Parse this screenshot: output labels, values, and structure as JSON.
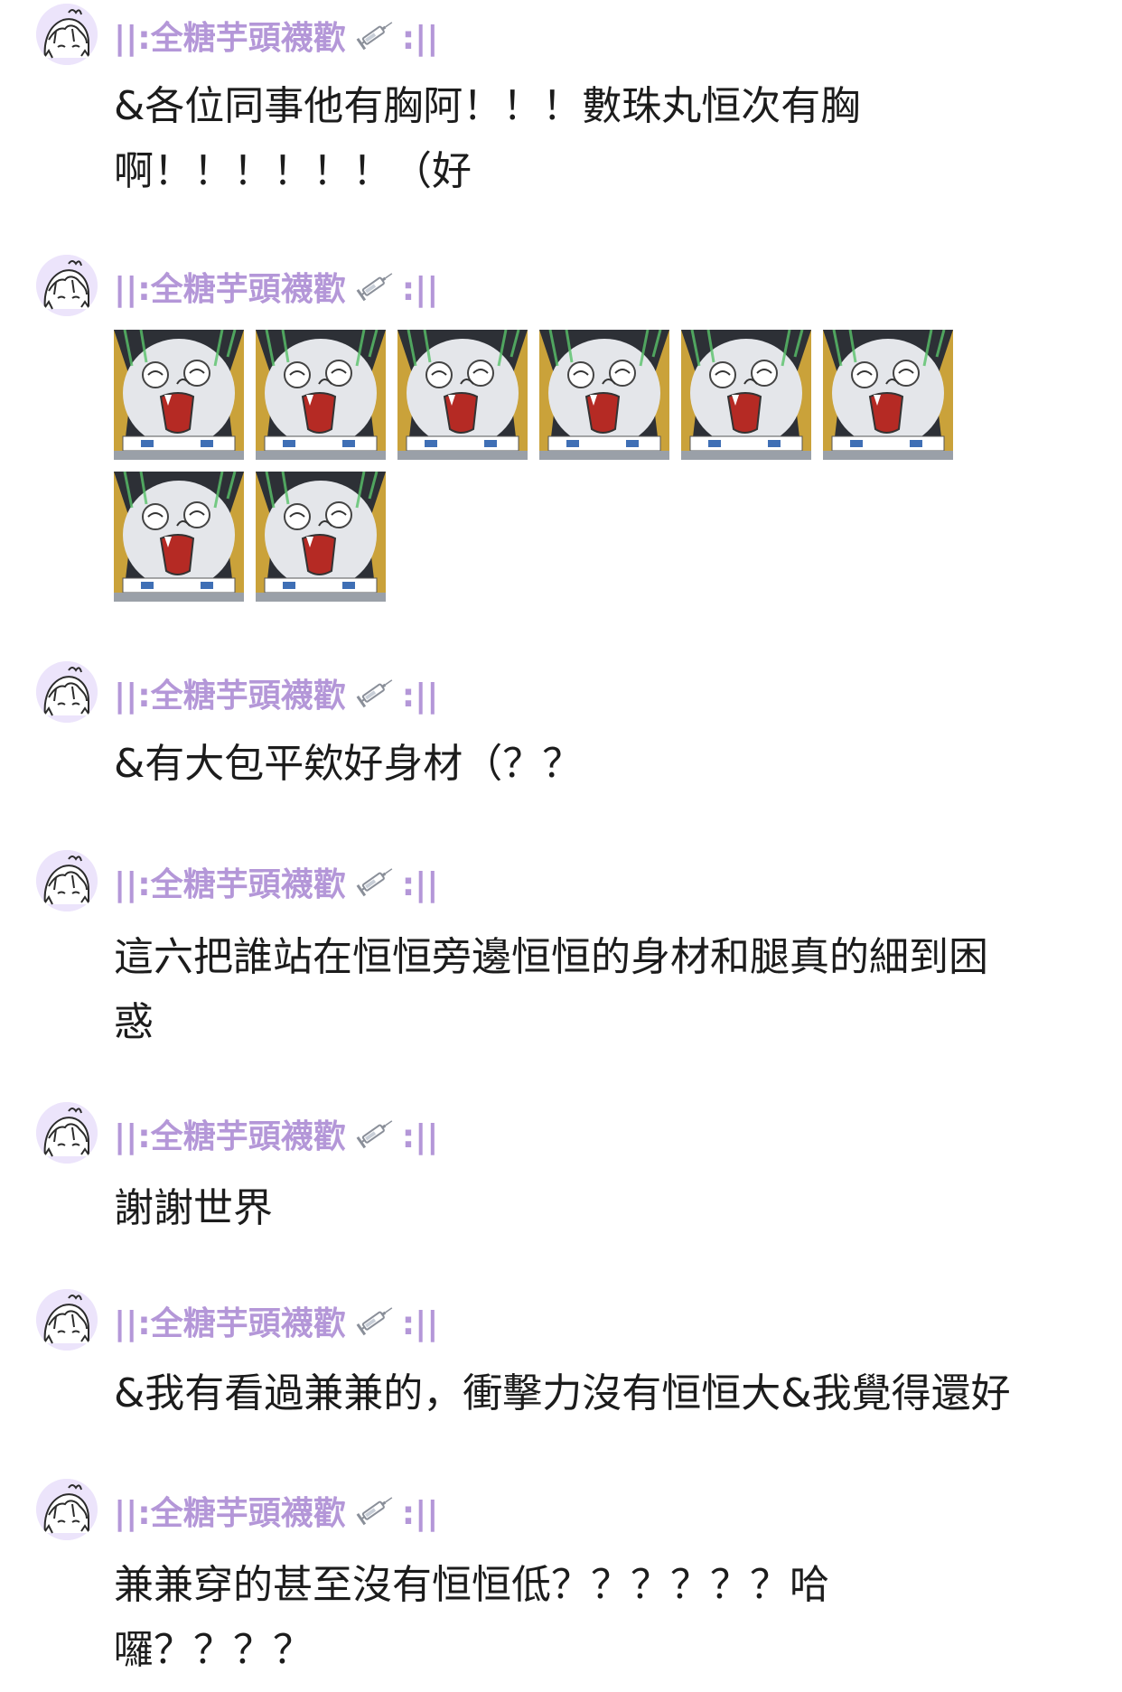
{
  "user": {
    "name": "||:全糖芋頭襪歡",
    "name_suffix": ":||",
    "avatar_icon": "girl-avatar-icon",
    "badge_icon": "syringe-icon",
    "name_color": "#b497d8"
  },
  "messages": [
    {
      "type": "text",
      "text": "&各位同事他有胸阿！！！數珠丸恒次有胸\n啊！！！！！！（好"
    },
    {
      "type": "stickers",
      "count": 8,
      "sticker_icon": "screaming-robot-sticker"
    },
    {
      "type": "text",
      "text": "&有大包平欸好身材（？？"
    },
    {
      "type": "text",
      "text": "這六把誰站在恒恒旁邊恒恒的身材和腿真的細到困\n惑"
    },
    {
      "type": "text",
      "text": "謝謝世界"
    },
    {
      "type": "text",
      "text": "&我有看過兼兼的，衝擊力沒有恒恒大&我覺得還好"
    },
    {
      "type": "text",
      "text": "兼兼穿的甚至沒有恒恒低？？？？？？哈\n囉？？？？"
    }
  ]
}
